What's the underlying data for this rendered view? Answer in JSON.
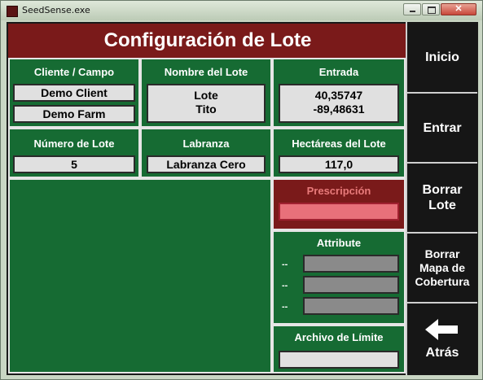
{
  "window": {
    "title": "SeedSense.exe"
  },
  "header": {
    "title": "Configuración de Lote"
  },
  "client_campo": {
    "label": "Cliente / Campo",
    "client": "Demo Client",
    "farm": "Demo Farm"
  },
  "lote": {
    "label": "Nombre del Lote",
    "line1": "Lote",
    "line2": "Tito"
  },
  "entrada": {
    "label": "Entrada",
    "line1": "40,35747",
    "line2": "-89,48631"
  },
  "numero_lote": {
    "label": "Número de Lote",
    "value": "5"
  },
  "labranza": {
    "label": "Labranza",
    "value": "Labranza Cero"
  },
  "hectareas": {
    "label": "Hectáreas del Lote",
    "value": "117,0"
  },
  "prescripcion": {
    "label": "Prescripción"
  },
  "attribute": {
    "label": "Attribute",
    "row_labels": [
      "--",
      "--",
      "--"
    ]
  },
  "limite": {
    "label": "Archivo de Límite"
  },
  "sidebar": {
    "inicio": "Inicio",
    "entrar": "Entrar",
    "borrar_lote_1": "Borrar",
    "borrar_lote_2": "Lote",
    "borrar_mapa_1": "Borrar",
    "borrar_mapa_2": "Mapa de",
    "borrar_mapa_3": "Cobertura",
    "atras": "Atrás"
  },
  "colors": {
    "panel_green": "#166b33",
    "header_red": "#7a1a1a",
    "prescription_pink": "#e8707a"
  }
}
